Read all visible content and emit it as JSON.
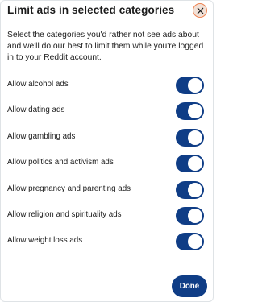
{
  "dialog": {
    "title": "Limit ads in selected categories",
    "description": "Select the categories you'd rather not see ads about and we'll do our best to limit them while you're logged in to your Reddit account.",
    "close_icon": "close-icon",
    "done_label": "Done"
  },
  "categories": [
    {
      "label": "Allow alcohol ads",
      "enabled": true
    },
    {
      "label": "Allow dating ads",
      "enabled": true
    },
    {
      "label": "Allow gambling ads",
      "enabled": true
    },
    {
      "label": "Allow politics and activism ads",
      "enabled": true
    },
    {
      "label": "Allow pregnancy and parenting ads",
      "enabled": true
    },
    {
      "label": "Allow religion and spirituality ads",
      "enabled": true
    },
    {
      "label": "Allow weight loss ads",
      "enabled": true
    }
  ],
  "colors": {
    "toggle_on": "#0f3d86",
    "primary_button": "#0f3d86",
    "close_accent": "#ee8454"
  }
}
